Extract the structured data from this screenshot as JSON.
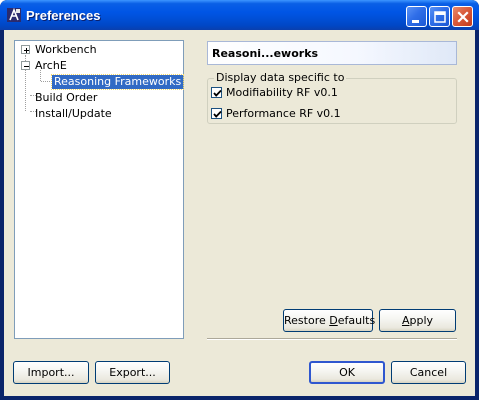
{
  "window": {
    "title": "Preferences"
  },
  "tree": {
    "items": [
      {
        "label": "Workbench",
        "expander": "+"
      },
      {
        "label": "ArchE",
        "expander": "-"
      },
      {
        "label": "Reasoning Frameworks",
        "selected": true
      },
      {
        "label": "Build Order"
      },
      {
        "label": "Install/Update"
      }
    ]
  },
  "page": {
    "title": "Reasoni...eworks",
    "group_label": "Display data specific to",
    "checkboxes": [
      {
        "label": "Modifiability RF v0.1",
        "checked": true
      },
      {
        "label": "Performance RF v0.1",
        "checked": true
      }
    ],
    "restore_defaults": {
      "pre": "Restore ",
      "accel": "D",
      "post": "efaults"
    },
    "apply": {
      "pre": "",
      "accel": "A",
      "post": "pply"
    }
  },
  "footer": {
    "import_label": "Import...",
    "export_label": "Export...",
    "ok_label": "OK",
    "cancel_label": "Cancel"
  },
  "colors": {
    "titlebar": "#0055e5",
    "selection": "#316ac5",
    "dialog_bg": "#ece9d8",
    "close_button": "#d95b3c"
  }
}
